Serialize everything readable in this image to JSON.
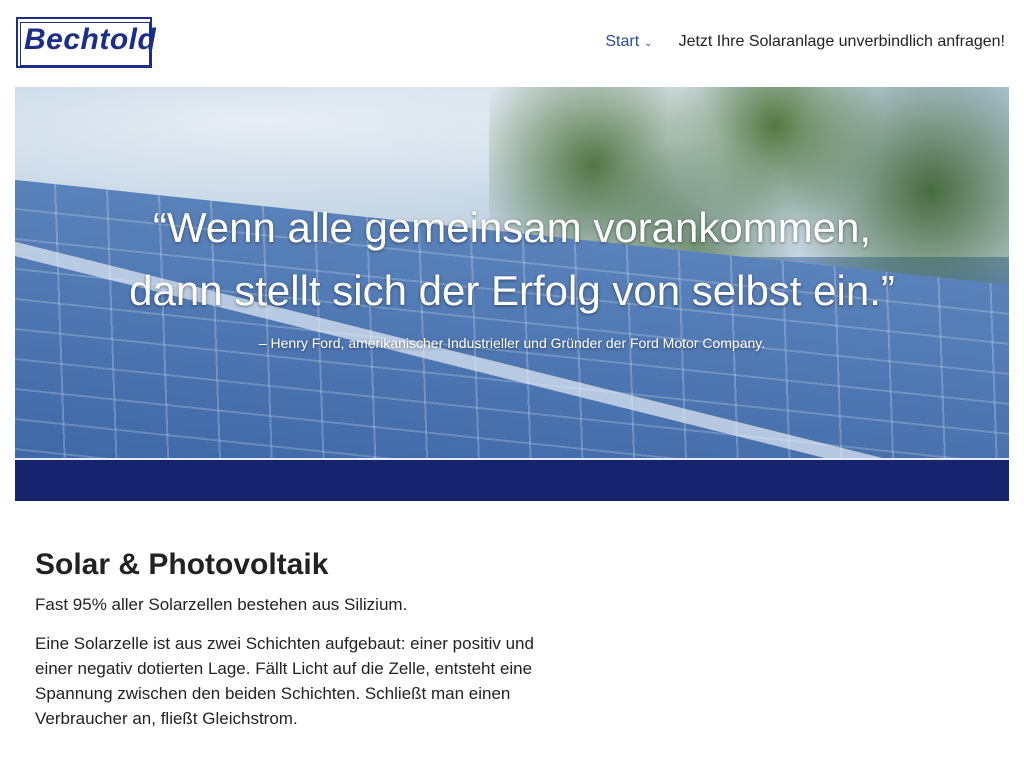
{
  "header": {
    "logo_text": "Bechtold",
    "nav": {
      "start_label": "Start",
      "cta_label": "Jetzt Ihre Solaranlage unverbindlich anfragen!"
    }
  },
  "hero": {
    "quote_line1": "“Wenn alle gemeinsam vorankommen,",
    "quote_line2": "dann stellt sich der Erfolg von selbst ein.”",
    "attribution": "– Henry Ford, amerikanischer Industrieller und Gründer der Ford Motor Company."
  },
  "main": {
    "title": "Solar & Photovoltaik",
    "paragraph1": "Fast 95% aller Solarzellen bestehen aus Silizium.",
    "paragraph2": "Eine Solarzelle ist aus zwei Schichten aufgebaut: einer positiv und einer negativ dotierten Lage. Fällt Licht auf die Zelle, entsteht eine Spannung zwischen den beiden Schichten. Schließt man einen Verbraucher an, fließt Gleichstrom."
  },
  "colors": {
    "brand_blue": "#1a2e8a",
    "band_navy": "#16246e",
    "nav_link": "#2b4a9a"
  }
}
